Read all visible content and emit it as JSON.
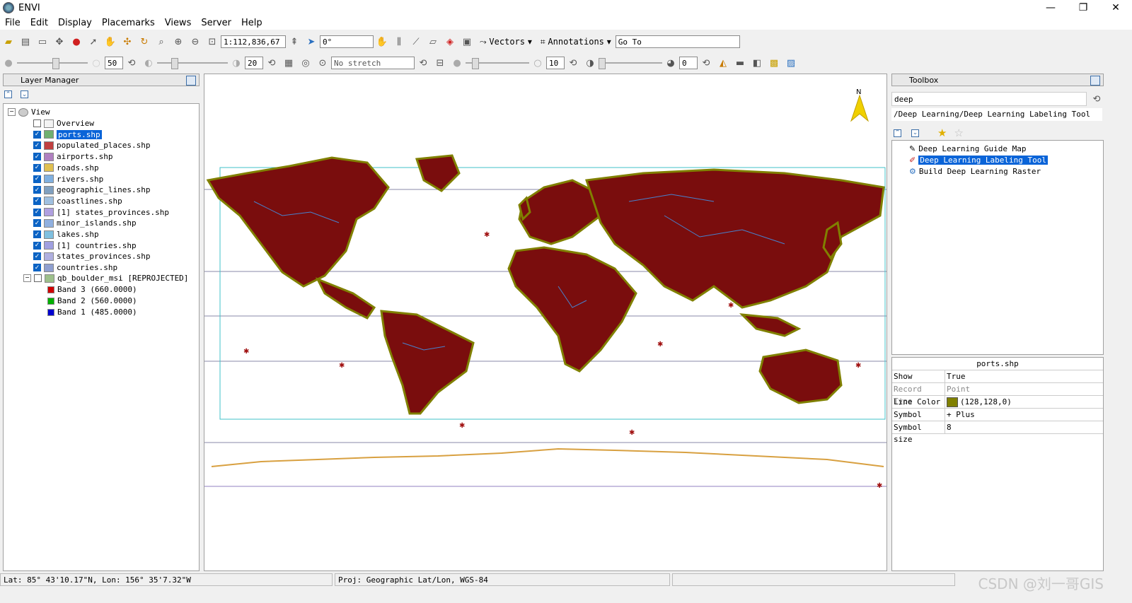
{
  "window": {
    "title": "ENVI",
    "minimize": "—",
    "restore": "❐",
    "close": "✕"
  },
  "menu": [
    "File",
    "Edit",
    "Display",
    "Placemarks",
    "Views",
    "Server",
    "Help"
  ],
  "toolbar1": {
    "scale_value": "1:112,836,67",
    "rotation_value": "0°",
    "vectors_label": "Vectors",
    "annotations_label": "Annotations",
    "goto_value": "Go To"
  },
  "toolbar2": {
    "brightness_value": "50",
    "contrast_value": "20",
    "stretch_value": "No stretch",
    "sharpen_value": "10",
    "transparency_value": "0"
  },
  "layer_manager": {
    "title": "Layer Manager",
    "root": "View",
    "layers": [
      {
        "label": "Overview",
        "checked": false,
        "selected": false
      },
      {
        "label": "ports.shp",
        "checked": true,
        "selected": true
      },
      {
        "label": "populated_places.shp",
        "checked": true,
        "selected": false
      },
      {
        "label": "airports.shp",
        "checked": true,
        "selected": false
      },
      {
        "label": "roads.shp",
        "checked": true,
        "selected": false
      },
      {
        "label": "rivers.shp",
        "checked": true,
        "selected": false
      },
      {
        "label": "geographic_lines.shp",
        "checked": true,
        "selected": false
      },
      {
        "label": "coastlines.shp",
        "checked": true,
        "selected": false
      },
      {
        "label": "[1] states_provinces.shp",
        "checked": true,
        "selected": false
      },
      {
        "label": "minor_islands.shp",
        "checked": true,
        "selected": false
      },
      {
        "label": "lakes.shp",
        "checked": true,
        "selected": false
      },
      {
        "label": "[1] countries.shp",
        "checked": true,
        "selected": false
      },
      {
        "label": "states_provinces.shp",
        "checked": true,
        "selected": false
      },
      {
        "label": "countries.shp",
        "checked": true,
        "selected": false
      },
      {
        "label": "qb_boulder_msi [REPROJECTED]",
        "checked": false,
        "selected": false
      }
    ],
    "bands": [
      {
        "label": "Band 3 (660.0000)",
        "color": "#d00000"
      },
      {
        "label": "Band 2 (560.0000)",
        "color": "#00b000"
      },
      {
        "label": "Band 1 (485.0000)",
        "color": "#0000d0"
      }
    ]
  },
  "toolbox": {
    "title": "Toolbox",
    "search_value": "deep",
    "path": "/Deep Learning/Deep Learning Labeling Tool",
    "items": [
      {
        "label": "Deep Learning Guide Map",
        "selected": false
      },
      {
        "label": "Deep Learning Labeling Tool",
        "selected": true
      },
      {
        "label": "Build Deep Learning Raster",
        "selected": false
      }
    ]
  },
  "properties": {
    "header": "ports.shp",
    "rows": [
      {
        "key": "Show",
        "value": "True"
      },
      {
        "key": "Record Type",
        "value": "Point"
      },
      {
        "key": "Line Color",
        "value": "(128,128,0)",
        "swatch": "#808000"
      },
      {
        "key": "Symbol",
        "value": "+  Plus"
      },
      {
        "key": "Symbol size",
        "value": "8"
      }
    ]
  },
  "map": {
    "north_label": "N"
  },
  "status": {
    "coords": "Lat: 85° 43'10.17\"N, Lon: 156° 35'7.32\"W",
    "proj": "Proj: Geographic Lat/Lon, WGS-84"
  },
  "watermark": "CSDN @刘一哥GIS"
}
